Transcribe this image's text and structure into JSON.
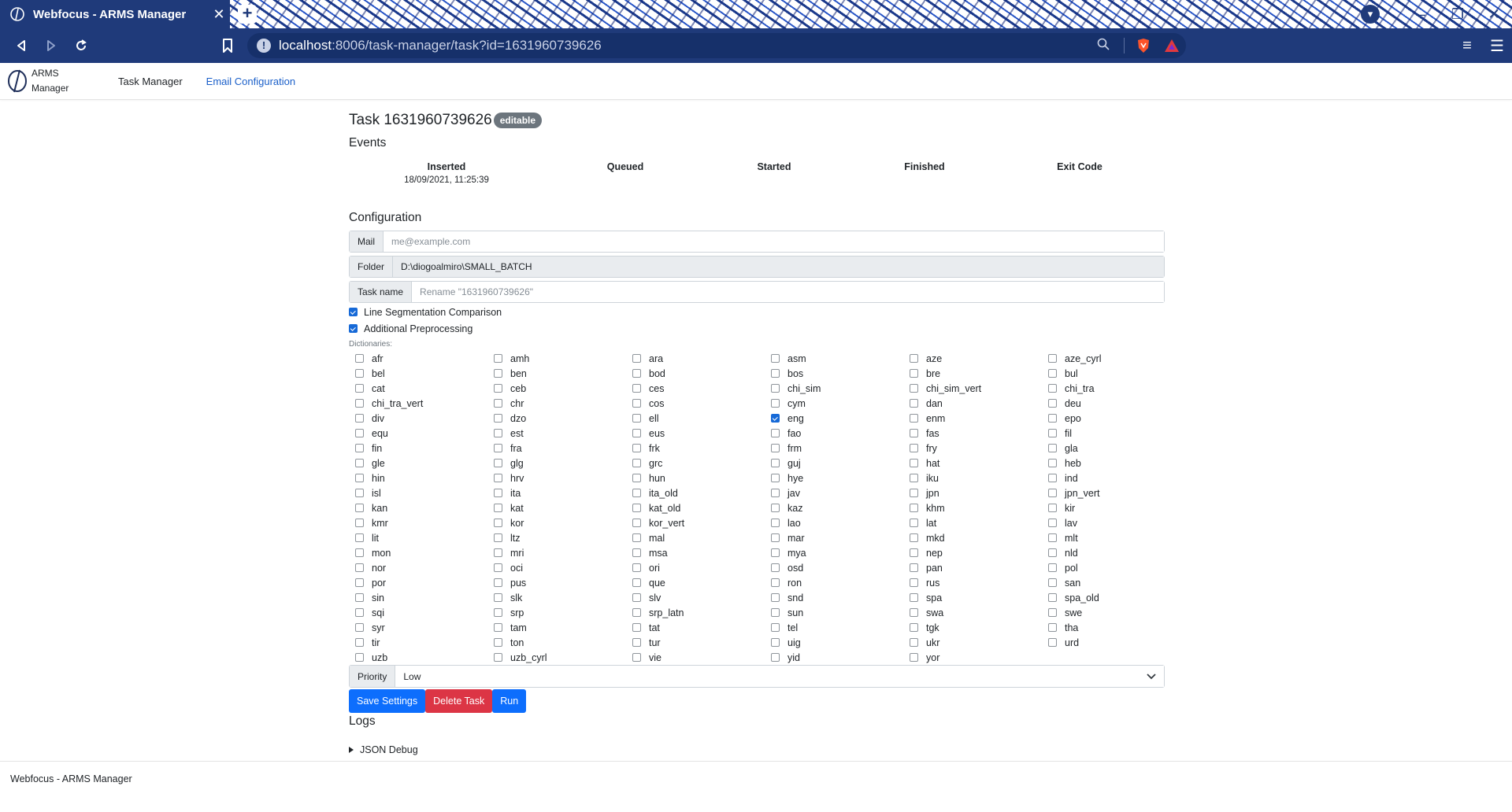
{
  "browser": {
    "tab_title": "Webfocus - ARMS Manager",
    "tab_close": "✕",
    "new_tab": "+",
    "url_host": "localhost",
    "url_rest": ":8006/task-manager/task?id=1631960739626"
  },
  "navbar": {
    "brand_line1": "ARMS",
    "brand_line2": "Manager",
    "links": [
      "Task Manager",
      "Email Configuration"
    ]
  },
  "task": {
    "title": "Task 1631960739626",
    "badge": "editable"
  },
  "events": {
    "heading": "Events",
    "columns": [
      "Inserted",
      "Queued",
      "Started",
      "Finished",
      "Exit Code"
    ],
    "values": [
      "18/09/2021, 11:25:39",
      "",
      "",
      "",
      ""
    ]
  },
  "configuration": {
    "heading": "Configuration",
    "mail_label": "Mail",
    "mail_placeholder": "me@example.com",
    "folder_label": "Folder",
    "folder_value": "D:\\diogoalmiro\\SMALL_BATCH",
    "taskname_label": "Task name",
    "taskname_placeholder": "Rename \"1631960739626\"",
    "line_seg_label": "Line Segmentation Comparison",
    "line_seg_checked": true,
    "preproc_label": "Additional Preprocessing",
    "preproc_checked": true,
    "dictionaries_label": "Dictionaries:",
    "dictionaries": [
      "afr",
      "amh",
      "ara",
      "asm",
      "aze",
      "aze_cyrl",
      "bel",
      "ben",
      "bod",
      "bos",
      "bre",
      "bul",
      "cat",
      "ceb",
      "ces",
      "chi_sim",
      "chi_sim_vert",
      "chi_tra",
      "chi_tra_vert",
      "chr",
      "cos",
      "cym",
      "dan",
      "deu",
      "div",
      "dzo",
      "ell",
      "eng",
      "enm",
      "epo",
      "equ",
      "est",
      "eus",
      "fao",
      "fas",
      "fil",
      "fin",
      "fra",
      "frk",
      "frm",
      "fry",
      "gla",
      "gle",
      "glg",
      "grc",
      "guj",
      "hat",
      "heb",
      "hin",
      "hrv",
      "hun",
      "hye",
      "iku",
      "ind",
      "isl",
      "ita",
      "ita_old",
      "jav",
      "jpn",
      "jpn_vert",
      "kan",
      "kat",
      "kat_old",
      "kaz",
      "khm",
      "kir",
      "kmr",
      "kor",
      "kor_vert",
      "lao",
      "lat",
      "lav",
      "lit",
      "ltz",
      "mal",
      "mar",
      "mkd",
      "mlt",
      "mon",
      "mri",
      "msa",
      "mya",
      "nep",
      "nld",
      "nor",
      "oci",
      "ori",
      "osd",
      "pan",
      "pol",
      "por",
      "pus",
      "que",
      "ron",
      "rus",
      "san",
      "sin",
      "slk",
      "slv",
      "snd",
      "spa",
      "spa_old",
      "sqi",
      "srp",
      "srp_latn",
      "sun",
      "swa",
      "swe",
      "syr",
      "tam",
      "tat",
      "tel",
      "tgk",
      "tha",
      "tir",
      "ton",
      "tur",
      "uig",
      "ukr",
      "urd",
      "uzb",
      "uzb_cyrl",
      "vie",
      "yid",
      "yor"
    ],
    "dictionaries_checked": [
      "eng"
    ],
    "priority_label": "Priority",
    "priority_value": "Low"
  },
  "actions": {
    "save": "Save Settings",
    "delete": "Delete Task",
    "run": "Run"
  },
  "logs": {
    "heading": "Logs",
    "json_debug": "JSON Debug"
  },
  "footer": {
    "text": "Webfocus - ARMS Manager"
  },
  "colors": {
    "browser_chrome": "#1f3a7a",
    "primary": "#0d6efd",
    "danger": "#dc3545",
    "badge": "#6c757d",
    "link": "#1a5fc9"
  }
}
